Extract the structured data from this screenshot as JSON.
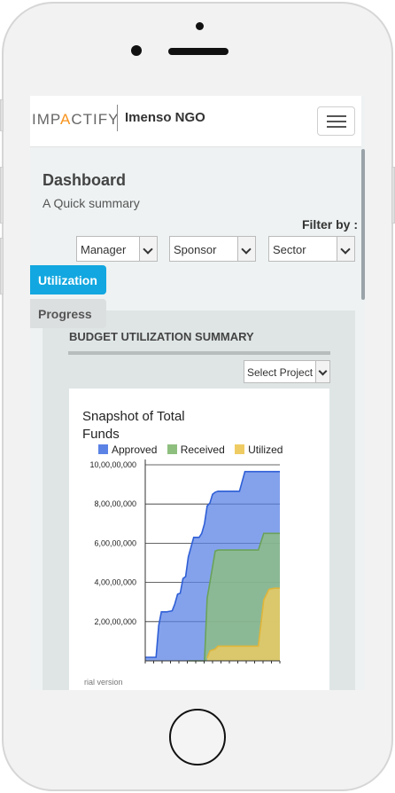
{
  "header": {
    "logo_prefix": "IMP",
    "logo_accent": "A",
    "logo_suffix": "CTIFY",
    "org_name": "Imenso NGO"
  },
  "dashboard": {
    "title": "Dashboard",
    "subtitle": "A Quick summary",
    "filter_label": "Filter by :"
  },
  "filters": {
    "manager": "Manager",
    "sponsor": "Sponsor",
    "sector": "Sector"
  },
  "tabs": {
    "utilization": "Utilization",
    "progress": "Progress"
  },
  "budget": {
    "section_title": "BUDGET UTILIZATION SUMMARY",
    "project_select": "Select Project"
  },
  "colors": {
    "accent": "#12a7e0",
    "logo_accent": "#f7931d",
    "approved": "#5b83e6",
    "received": "#8fbf7f",
    "utilized": "#efcc63"
  },
  "trial_text": "rial version",
  "chart_data": {
    "type": "area",
    "title": "Snapshot of Total Funds",
    "y_tick_labels": [
      "10,00,00,000",
      "8,00,00,000",
      "6,00,00,000",
      "4,00,00,000",
      "2,00,00,000"
    ],
    "y_ticks": [
      100000000,
      80000000,
      60000000,
      40000000,
      20000000
    ],
    "ylim": [
      0,
      100000000
    ],
    "grid": true,
    "legend_position": "top",
    "x": [
      0,
      4,
      5,
      6,
      8,
      10,
      11,
      12,
      13,
      14,
      15,
      16,
      18,
      20,
      21,
      22,
      23,
      24,
      25,
      26,
      27,
      28,
      29,
      31,
      33,
      35,
      37,
      40,
      42,
      44,
      46,
      48,
      50
    ],
    "series": [
      {
        "name": "Approved",
        "color": "#5b83e6",
        "values": [
          1800000,
          1800000,
          18000000,
          25000000,
          25000000,
          25500000,
          29000000,
          34000000,
          34500000,
          42000000,
          43000000,
          53000000,
          63000000,
          63000000,
          65000000,
          70000000,
          79000000,
          80500000,
          85000000,
          86000000,
          86500000,
          86500000,
          86500000,
          86500000,
          86500000,
          86500000,
          96500000,
          96500000,
          96500000,
          96500000,
          96500000,
          96500000,
          96500000
        ]
      },
      {
        "name": "Received",
        "color": "#8fbf7f",
        "values": [
          null,
          null,
          null,
          null,
          null,
          null,
          null,
          null,
          null,
          null,
          null,
          0,
          0,
          0,
          0,
          0,
          32000000,
          40000000,
          48000000,
          56000000,
          56500000,
          56500000,
          56500000,
          56500000,
          56500000,
          56500000,
          56500000,
          56500000,
          56500000,
          65000000,
          65000000,
          65000000,
          65000000
        ]
      },
      {
        "name": "Utilized",
        "color": "#efcc63",
        "values": [
          null,
          null,
          null,
          null,
          null,
          null,
          null,
          null,
          null,
          null,
          null,
          null,
          null,
          null,
          null,
          null,
          1500000,
          5000000,
          5500000,
          6000000,
          7500000,
          7500000,
          7500000,
          7500000,
          7500000,
          7500000,
          7500000,
          7500000,
          7500000,
          31000000,
          36500000,
          37000000,
          37000000
        ]
      }
    ]
  }
}
